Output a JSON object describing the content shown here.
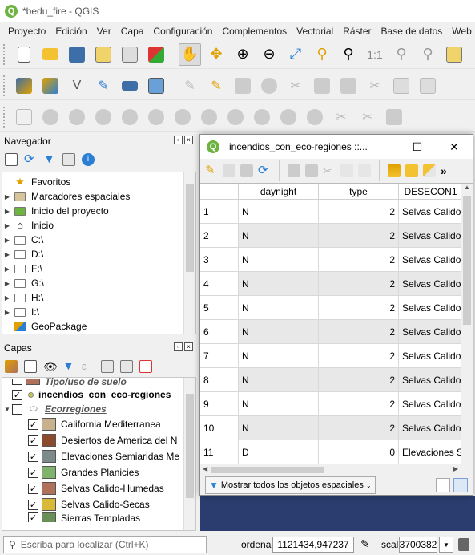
{
  "app": {
    "title": "*bedu_fire - QGIS"
  },
  "menu": [
    "Proyecto",
    "Edición",
    "Ver",
    "Capa",
    "Configuración",
    "Complementos",
    "Vectorial",
    "Ráster",
    "Base de datos",
    "Web"
  ],
  "colors": {
    "accent": "#589632",
    "map_background": "#2a3d6e",
    "alt_row": "#e8e8e8"
  },
  "navigator": {
    "title": "Navegador",
    "items": [
      {
        "label": "Favoritos",
        "icon": "star-icon",
        "expand": false
      },
      {
        "label": "Marcadores espaciales",
        "icon": "bookmark-folder-icon",
        "expand": true
      },
      {
        "label": "Inicio del proyecto",
        "icon": "project-home-icon",
        "expand": true
      },
      {
        "label": "Inicio",
        "icon": "home-icon",
        "expand": true
      },
      {
        "label": "C:\\",
        "icon": "folder-icon",
        "expand": true
      },
      {
        "label": "D:\\",
        "icon": "folder-icon",
        "expand": true
      },
      {
        "label": "F:\\",
        "icon": "folder-icon",
        "expand": true
      },
      {
        "label": "G:\\",
        "icon": "folder-icon",
        "expand": true
      },
      {
        "label": "H:\\",
        "icon": "folder-icon",
        "expand": true
      },
      {
        "label": "I:\\",
        "icon": "folder-icon",
        "expand": true
      },
      {
        "label": "GeoPackage",
        "icon": "geopackage-icon",
        "expand": false
      }
    ]
  },
  "layers": {
    "title": "Capas",
    "items": [
      {
        "label": "Tipo/uso de suelo",
        "type": "partial"
      },
      {
        "label": "incendios_con_eco-regiones",
        "type": "point"
      },
      {
        "label": "Ecorregiones",
        "type": "group"
      }
    ],
    "classes": [
      {
        "label": "California Mediterranea",
        "color": "#c8b18f"
      },
      {
        "label": "Desiertos de America del N",
        "color": "#8b4a2e"
      },
      {
        "label": "Elevaciones Semiaridas Me",
        "color": "#7d8a8b"
      },
      {
        "label": "Grandes Planicies",
        "color": "#7fb36b"
      },
      {
        "label": "Selvas Calido-Humedas",
        "color": "#b0715c"
      },
      {
        "label": "Selvas Calido-Secas",
        "color": "#d9b83a"
      },
      {
        "label": "Sierras Templadas",
        "color": "#6a8f56"
      }
    ]
  },
  "attribute_table": {
    "title": "incendios_con_eco-regiones ::...",
    "headers": [
      "daynight",
      "type",
      "DESECON1"
    ],
    "rows": [
      [
        "1",
        "N",
        "2",
        "Selvas Calido-"
      ],
      [
        "2",
        "N",
        "2",
        "Selvas Calido-"
      ],
      [
        "3",
        "N",
        "2",
        "Selvas Calido-"
      ],
      [
        "4",
        "N",
        "2",
        "Selvas Calido-"
      ],
      [
        "5",
        "N",
        "2",
        "Selvas Calido-"
      ],
      [
        "6",
        "N",
        "2",
        "Selvas Calido-"
      ],
      [
        "7",
        "N",
        "2",
        "Selvas Calido-"
      ],
      [
        "8",
        "N",
        "2",
        "Selvas Calido-"
      ],
      [
        "9",
        "N",
        "2",
        "Selvas Calido-"
      ],
      [
        "10",
        "N",
        "2",
        "Selvas Calido-"
      ],
      [
        "11",
        "D",
        "0",
        "Elevaciones Se"
      ]
    ],
    "filter_label": "Mostrar todos los objetos espaciales"
  },
  "status": {
    "locator_placeholder": "Escriba para localizar (Ctrl+K)",
    "coord_label": "ordena",
    "coord_value": "1121434,947237",
    "scale_label": "scal",
    "scale_value": "3700382"
  }
}
